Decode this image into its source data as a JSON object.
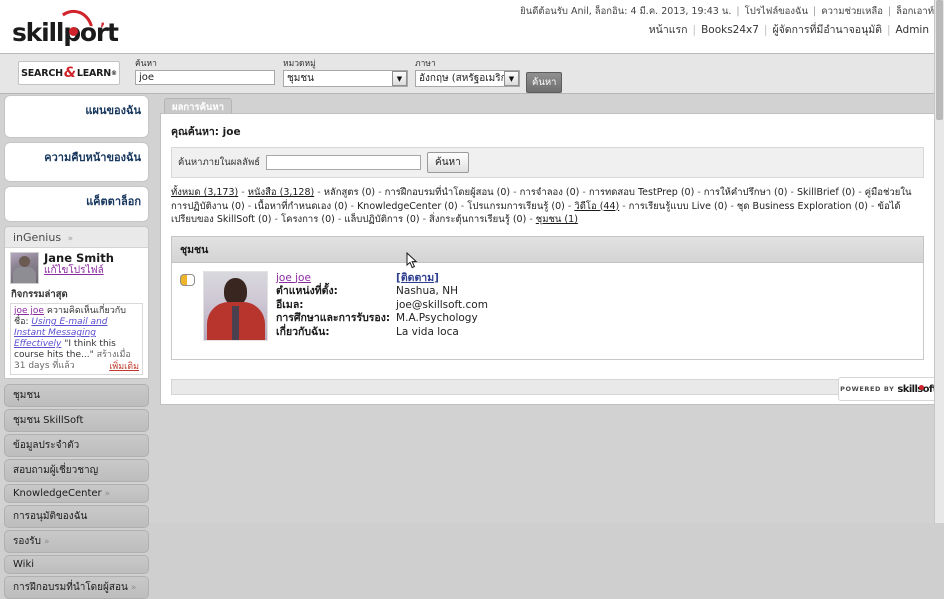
{
  "header": {
    "welcome": "ยินดีต้อนรับ Anil, ล็อกอิน: 4 มี.ค. 2013, 19:43 น.",
    "util_links": [
      "โปรไฟล์ของฉัน",
      "ความช่วยเหลือ",
      "ล็อกเอาท์"
    ],
    "nav_links": [
      "หน้าแรก",
      "Books24x7",
      "ผู้จัดการที่มีอำนาจอนุมัติ",
      "Admin"
    ],
    "logo_text": "skillport"
  },
  "searchbar": {
    "badge_left": "SEARCH",
    "badge_amp": "&",
    "badge_right": "LEARN",
    "badge_sup": "®",
    "search_label": "ค้นหา",
    "search_value": "joe",
    "category_label": "หมวดหมู่",
    "category_value": "ชุมชน",
    "language_label": "ภาษา",
    "language_value": "อังกฤษ (สหรัฐอเมริกา)",
    "search_button": "ค้นหา"
  },
  "sidebar": {
    "cards": [
      {
        "title": "แผนของฉัน"
      },
      {
        "title": "ความคืบหน้าของฉัน"
      },
      {
        "title": "แค็ตตาล็อก"
      }
    ],
    "ingenius": {
      "title": "inGenius",
      "user_name": "Jane Smith",
      "edit_profile": "แก้ไขโปรไฟล์",
      "activity_title": "กิจกรรมล่าสุด",
      "activity_author": "joe joe",
      "activity_text": "ความคิดเห็นเกี่ยวกับชื่อ:",
      "activity_item": "Using E-mail and Instant Messaging Effectively",
      "activity_quote": "\"I think this course hits the...\"",
      "activity_meta": "สร้างเมื่อ 31 days ที่แล้ว",
      "activity_more": "เพิ่มเติม"
    },
    "nav_items": [
      {
        "label": "ชุมชน",
        "chevron": false
      },
      {
        "label": "ชุมชน SkillSoft",
        "chevron": false
      },
      {
        "label": "ข้อมูลประจำตัว",
        "chevron": false
      },
      {
        "label": "สอบถามผู้เชี่ยวชาญ",
        "chevron": false
      },
      {
        "label": "KnowledgeCenter",
        "chevron": true
      },
      {
        "label": "การอนุมัติของฉัน",
        "chevron": false
      },
      {
        "label": "รองรับ",
        "chevron": true
      },
      {
        "label": "Wiki",
        "chevron": false
      },
      {
        "label": "การฝึกอบรมที่นำโดยผู้สอน",
        "chevron": true
      }
    ]
  },
  "main": {
    "tab_label": "ผลการค้นหา",
    "you_searched": "คุณค้นหา: joe",
    "refine_label": "ค้นหาภายในผลลัพธ์",
    "refine_value": "",
    "refine_button": "ค้นหา",
    "facets": [
      {
        "label": "ทั้งหมด (3,173)",
        "link": true
      },
      {
        "label": "หนังสือ (3,128)",
        "link": true
      },
      {
        "label": "หลักสูตร (0)",
        "link": false
      },
      {
        "label": "การฝึกอบรมที่นำโดยผู้สอน (0)",
        "link": false
      },
      {
        "label": "การจำลอง (0)",
        "link": false
      },
      {
        "label": "การทดสอบ TestPrep (0)",
        "link": false
      },
      {
        "label": "การให้คำปรึกษา (0)",
        "link": false
      },
      {
        "label": "SkillBrief (0)",
        "link": false
      },
      {
        "label": "คู่มือช่วยในการปฏิบัติงาน (0)",
        "link": false
      },
      {
        "label": "เนื้อหาที่กำหนดเอง (0)",
        "link": false
      },
      {
        "label": "KnowledgeCenter (0)",
        "link": false
      },
      {
        "label": "โปรแกรมการเรียนรู้ (0)",
        "link": false
      },
      {
        "label": "วิดีโอ (44)",
        "link": true
      },
      {
        "label": "การเรียนรู้แบบ Live (0)",
        "link": false
      },
      {
        "label": "ชุด Business Exploration (0)",
        "link": false
      },
      {
        "label": "ข้อได้เปรียบของ SkillSoft (0)",
        "link": false
      },
      {
        "label": "โครงการ (0)",
        "link": false
      },
      {
        "label": "แล็บปฏิบัติการ (0)",
        "link": false
      },
      {
        "label": "สิ่งกระตุ้นการเรียนรู้ (0)",
        "link": false
      },
      {
        "label": "ชุมชน (1)",
        "link": true
      }
    ],
    "result_group_title": "ชุมชน",
    "result": {
      "name": "joe joe",
      "follow_label": "[ติดตาม]",
      "fields": [
        {
          "label": "ตำแหน่งที่ตั้ง:",
          "value": "Nashua, NH"
        },
        {
          "label": "อีเมล:",
          "value": "joe@skillsoft.com"
        },
        {
          "label": "การศึกษาและการรับรอง:",
          "value": "M.A.Psychology"
        },
        {
          "label": "เกี่ยวกับฉัน:",
          "value": "La vida loca"
        }
      ]
    }
  },
  "footer": {
    "powered_by": "POWERED BY",
    "powered_logo": "skillsoft"
  }
}
